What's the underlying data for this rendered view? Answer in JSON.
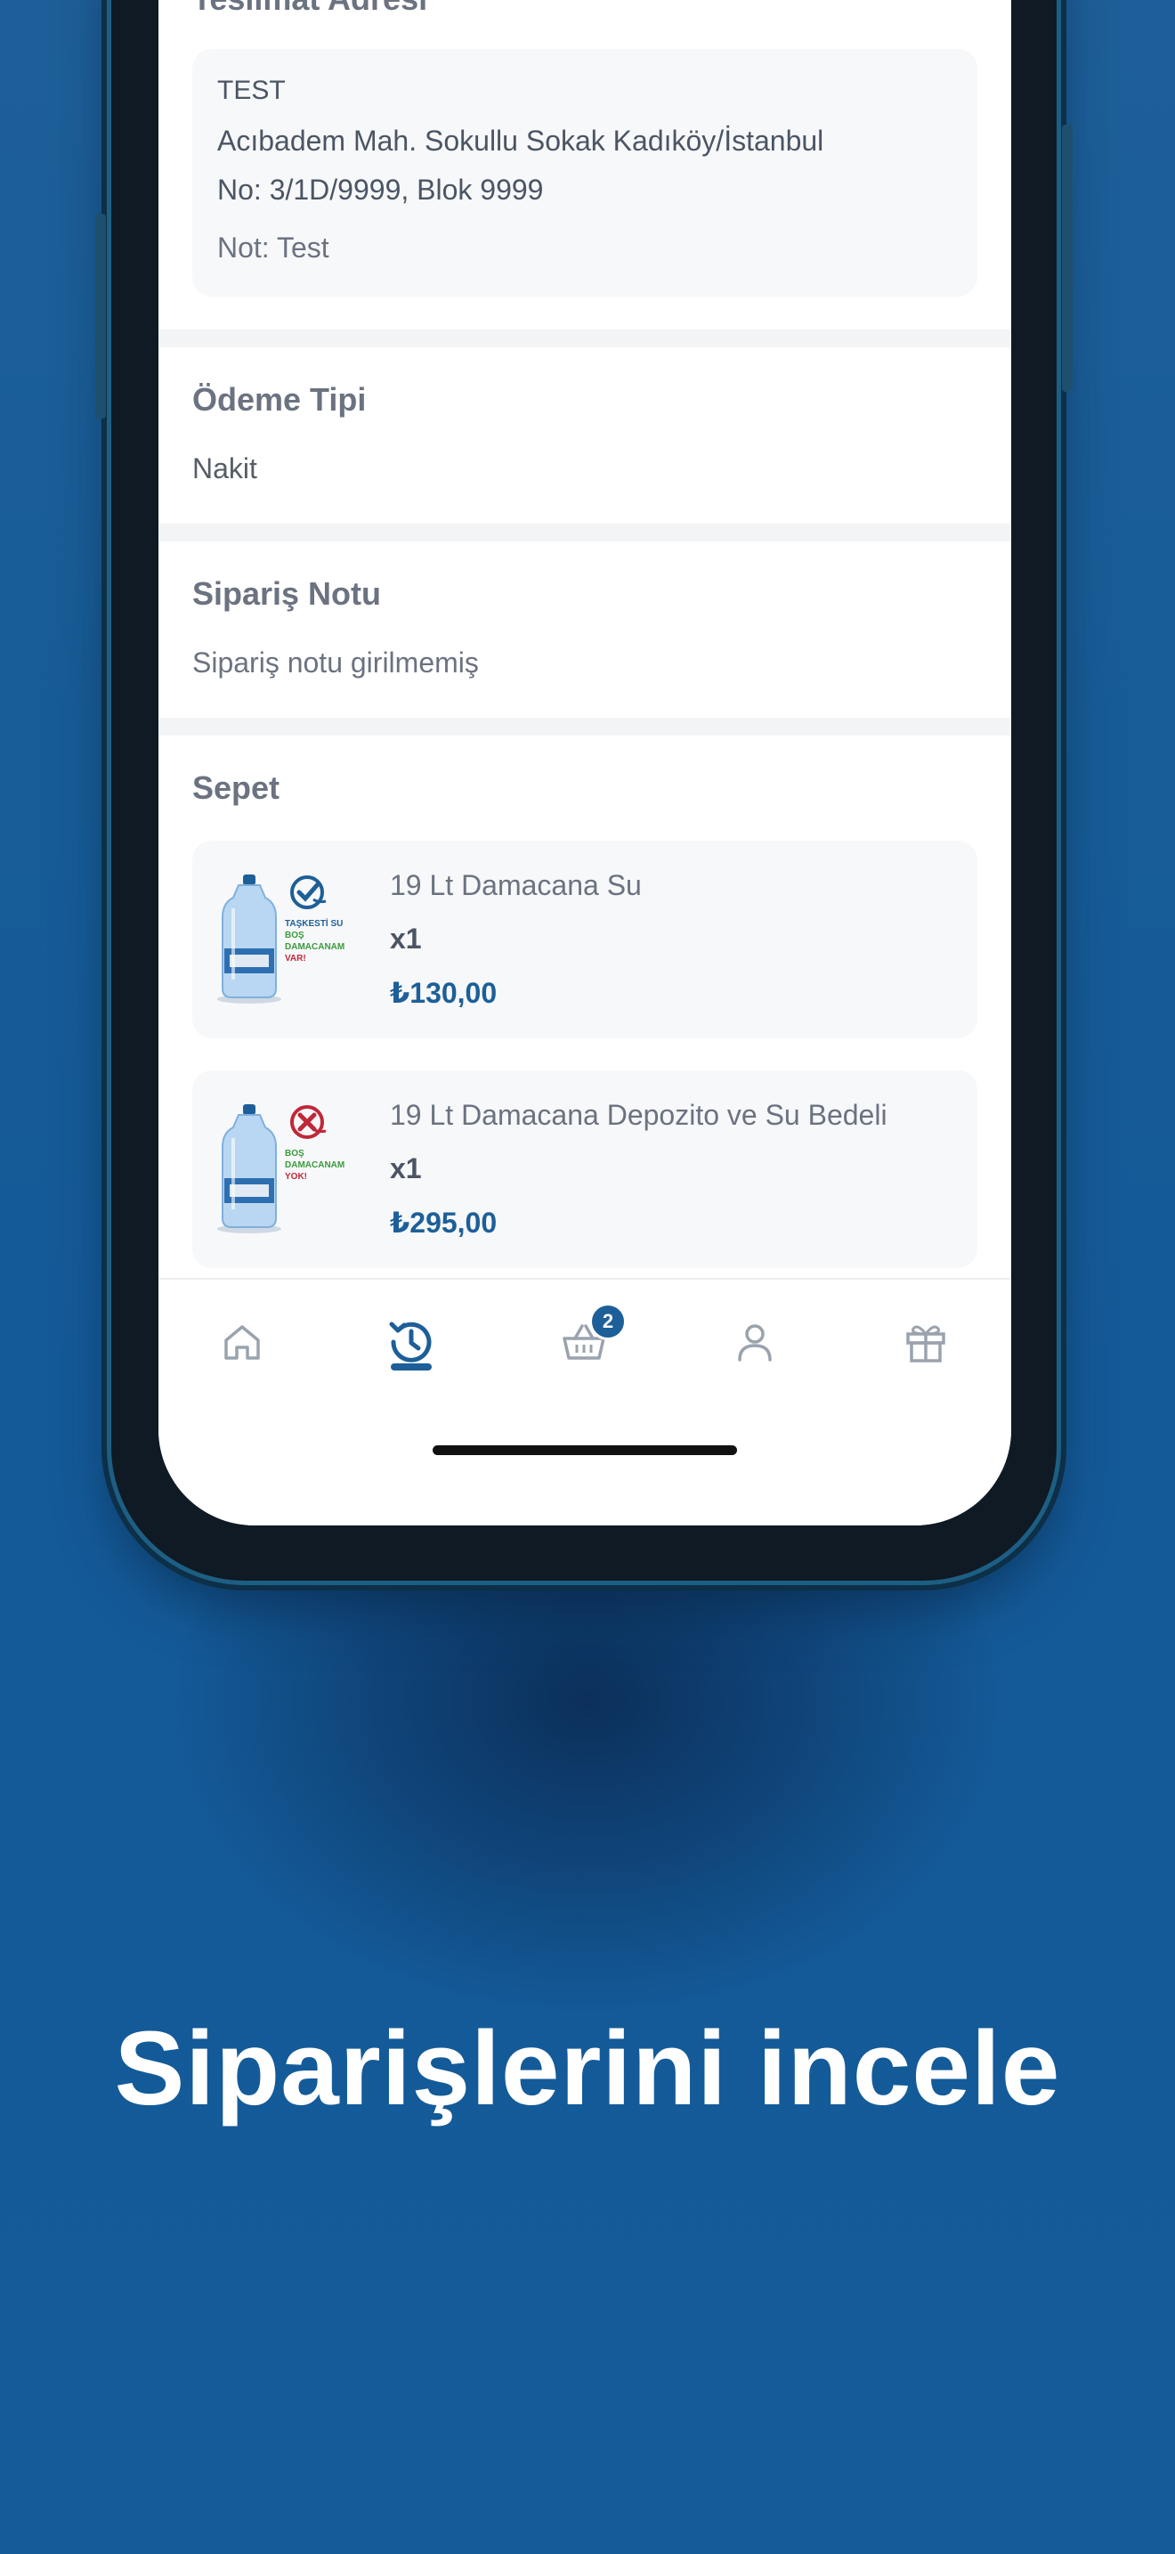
{
  "delivery": {
    "title": "Teslimat Adresi",
    "name": "TEST",
    "address_line1": "Acıbadem Mah. Sokullu Sokak Kadıköy/İstanbul",
    "address_line2": "No: 3/1D/9999, Blok 9999",
    "note": "Not: Test"
  },
  "payment": {
    "title": "Ödeme Tipi",
    "value": "Nakit"
  },
  "order_note": {
    "title": "Sipariş Notu",
    "value": "Sipariş notu girilmemiş"
  },
  "cart": {
    "title": "Sepet",
    "items": [
      {
        "name": "19 Lt Damacana Su",
        "qty": "x1",
        "price": "₺130,00",
        "badge_lines": [
          "TAŞKESTİ SU",
          "BOŞ",
          "DAMACANAM",
          "VAR!"
        ]
      },
      {
        "name": "19 Lt Damacana Depozito ve Su Bedeli",
        "qty": "x1",
        "price": "₺295,00",
        "badge_lines": [
          "BOŞ",
          "DAMACANAM",
          "YOK!"
        ]
      }
    ]
  },
  "tabbar": {
    "tabs": [
      "home-icon",
      "history-icon",
      "basket-icon",
      "user-icon",
      "gift-icon"
    ],
    "active": "history-icon",
    "basket_count": "2"
  },
  "caption": "Siparişlerini incele",
  "colors": {
    "accent": "#1d5f98",
    "background": "#175c97",
    "check": "#1d5f98",
    "cross": "#c0283a",
    "green_text": "#3a9a3c"
  }
}
